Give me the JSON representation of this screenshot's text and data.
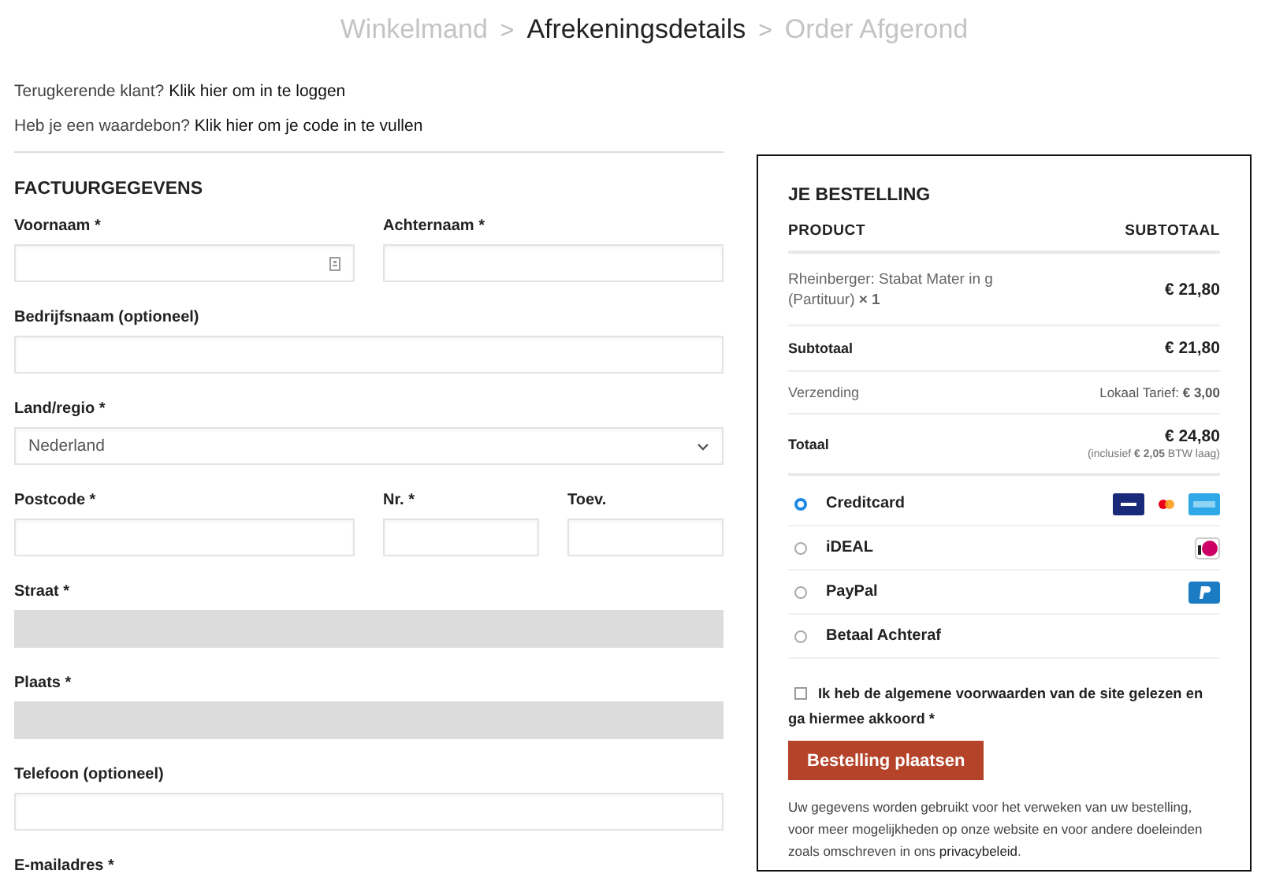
{
  "steps": [
    {
      "label": "Winkelmand",
      "selected": false
    },
    {
      "label": "Afrekeningsdetails",
      "selected": true
    },
    {
      "label": "Order Afgerond",
      "selected": false
    }
  ],
  "step_separator": ">",
  "notices": [
    {
      "text": "Terugkerende klant? ",
      "link": "Klik hier om in te loggen"
    },
    {
      "text": "Heb je een waardebon? ",
      "link": "Klik hier om je code in te vullen"
    }
  ],
  "billing": {
    "title": "FACTUURGEGEVENS",
    "rows": [
      [
        {
          "label": "Voornaam *",
          "kind": "autofill",
          "disabled": false
        },
        {
          "label": "Achternaam *",
          "kind": "text",
          "disabled": false
        }
      ],
      [
        {
          "label": "Bedrijfsnaam (optioneel)",
          "kind": "text",
          "disabled": false
        }
      ],
      [
        {
          "label": "Land/regio *",
          "kind": "select",
          "value": "Nederland",
          "disabled": false
        }
      ],
      [
        {
          "label": "Postcode *",
          "kind": "text",
          "disabled": false
        },
        {
          "label": "Nr. *",
          "kind": "text",
          "disabled": false
        },
        {
          "label": "Toev.",
          "kind": "text",
          "disabled": false
        }
      ],
      [
        {
          "label": "Straat *",
          "kind": "text",
          "disabled": true
        }
      ],
      [
        {
          "label": "Plaats *",
          "kind": "text",
          "disabled": true
        }
      ],
      [
        {
          "label": "Telefoon (optioneel)",
          "kind": "text",
          "disabled": false
        }
      ],
      [
        {
          "label": "E-mailadres *",
          "kind": "label-only"
        }
      ]
    ]
  },
  "order": {
    "title": "JE BESTELLING",
    "columns": [
      "PRODUCT",
      "SUBTOTAAL"
    ],
    "items": [
      {
        "product": "Rheinberger: Stabat Mater in g (Partituur) **× 1**",
        "price": "€ 21,80"
      }
    ],
    "totals": [
      {
        "label": "Subtotaal",
        "value": "€ 21,80",
        "strong": true
      },
      {
        "label": "Verzending",
        "value": "Lokaal Tarief: **€ 3,00**",
        "strong": false
      },
      {
        "label": "Totaal",
        "value": "€ 24,80",
        "note": "(inclusief **€ 2,05** BTW laag)",
        "strong": true
      }
    ],
    "payments": [
      {
        "label": "Creditcard",
        "kind": "card",
        "selected": true
      },
      {
        "label": "iDEAL",
        "kind": "ideal",
        "selected": false
      },
      {
        "label": "PayPal",
        "kind": "paypal",
        "selected": false
      },
      {
        "label": "Betaal Achteraf",
        "kind": "none",
        "selected": false
      }
    ],
    "terms": {
      "text": "Ik heb de algemene voorwaarden van de site gelezen en ga hiermee akkoord *",
      "checked": false
    },
    "button": "Bestelling plaatsen",
    "privacy": {
      "text": "Uw gegevens worden gebruikt voor het verweken van uw bestelling, voor meer mogelijkheden op onze website en voor andere doeleinden zoals omschreven in ons ",
      "link": "privacybeleid",
      "after": "."
    }
  }
}
